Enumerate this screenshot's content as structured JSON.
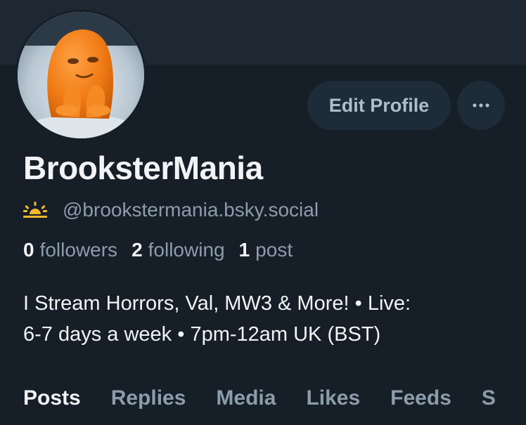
{
  "profile": {
    "display_name": "BrooksterMania",
    "handle": "@brookstermania.bsky.social",
    "handle_icon": "sunrise-emoji-icon",
    "bio_lines": [
      "I Stream Horrors, Val, MW3 & More! • Live:",
      "6-7 days a week • 7pm-12am UK (BST)"
    ]
  },
  "stats": {
    "followers_count": "0",
    "followers_label": "followers",
    "following_count": "2",
    "following_label": "following",
    "posts_count": "1",
    "posts_label": "post"
  },
  "actions": {
    "edit_profile_label": "Edit Profile",
    "more_icon": "ellipsis-icon"
  },
  "tabs": [
    {
      "label": "Posts",
      "active": true
    },
    {
      "label": "Replies",
      "active": false
    },
    {
      "label": "Media",
      "active": false
    },
    {
      "label": "Likes",
      "active": false
    },
    {
      "label": "Feeds",
      "active": false
    },
    {
      "label": "S",
      "active": false
    }
  ],
  "colors": {
    "background": "#161e27",
    "banner": "#1e2833",
    "button_bg": "#1e2b38",
    "primary_text": "#f1f3f5",
    "secondary_text": "#8d9cab",
    "sun_emoji": "#f5b82e"
  }
}
